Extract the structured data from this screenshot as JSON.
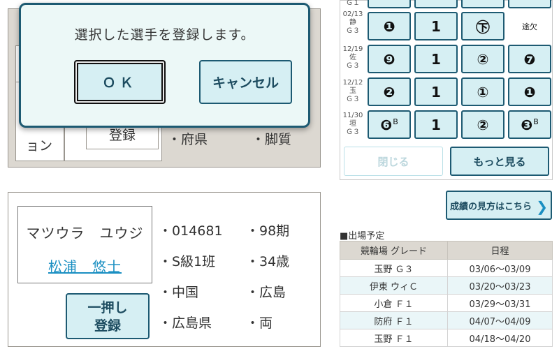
{
  "dialog": {
    "message": "選択した選手を登録します。",
    "ok_label": "ＯＫ",
    "cancel_label": "キャンセル"
  },
  "background_card": {
    "partial_label_1": "ョン",
    "partial_label_2": "登録",
    "prefecture_frag": "・府県",
    "leg_frag": "・脚質"
  },
  "player": {
    "kana": "マツウラ　ユウジ",
    "kanji": "松浦　悠士",
    "oneclick_label_1": "一押し",
    "oneclick_label_2": "登録",
    "info": [
      "・014681",
      "・98期",
      "・S級1班",
      "・34歳",
      "・中国",
      "・広島",
      "・広島県",
      "・両"
    ]
  },
  "results": {
    "rows": [
      {
        "date": "",
        "venue": "",
        "grade": "Ｇ１",
        "cells": [
          "",
          "",
          "",
          ""
        ]
      },
      {
        "date": "02/13",
        "venue": "静",
        "grade": "Ｇ３",
        "cells": [
          "❶",
          "1",
          "㊦",
          "途欠"
        ]
      },
      {
        "date": "12/19",
        "venue": "佐",
        "grade": "Ｇ３",
        "cells": [
          "❾",
          "1",
          "②",
          "❼"
        ]
      },
      {
        "date": "12/12",
        "venue": "玉",
        "grade": "Ｇ３",
        "cells": [
          "❷",
          "1",
          "①",
          "❶"
        ]
      },
      {
        "date": "11/30",
        "venue": "垣",
        "grade": "Ｇ３",
        "cells": [
          "❻",
          "1",
          "②",
          "❸"
        ]
      }
    ],
    "superscripts": [
      "B",
      "B"
    ],
    "close_label": "閉じる",
    "more_label": "もっと見る",
    "howto_label": "成績の見方はこちら",
    "howto_chevron": "chevron-right-icon"
  },
  "schedule": {
    "title": "■出場予定",
    "headers": [
      "競輪場 グレード",
      "日程"
    ],
    "rows": [
      [
        "玉野 Ｇ３",
        "03/06〜03/09"
      ],
      [
        "伊東 ウィＣ",
        "03/20〜03/23"
      ],
      [
        "小倉 Ｆ１",
        "03/29〜03/31"
      ],
      [
        "防府 Ｆ１",
        "04/07〜04/09"
      ],
      [
        "玉野 Ｆ１",
        "04/18〜04/20"
      ]
    ]
  },
  "colors": {
    "accent": "#1d5a72",
    "button_fill": "#d6eff3",
    "link": "#1a8fc2",
    "card_gray": "#dcd8d1"
  }
}
